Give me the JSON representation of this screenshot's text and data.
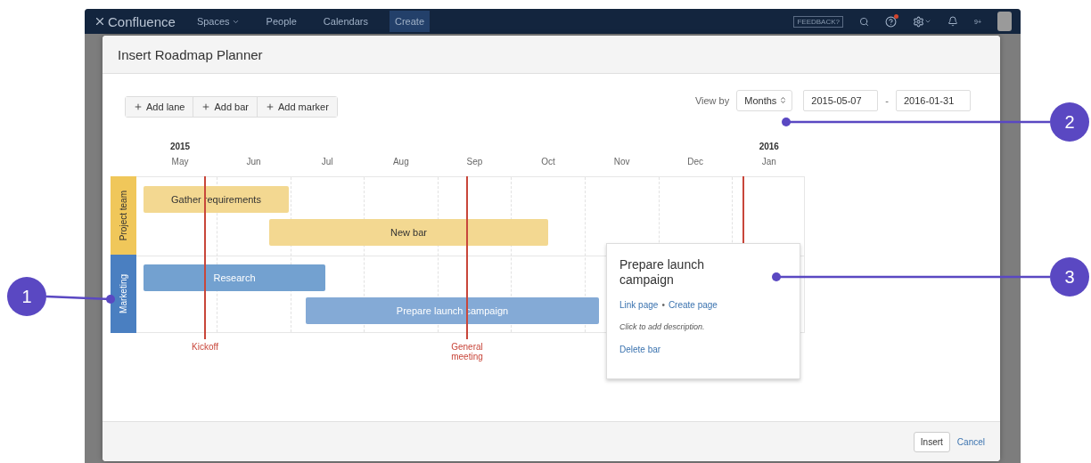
{
  "app": {
    "logo": "Confluence",
    "nav": [
      {
        "label": "Spaces",
        "dropdown": true,
        "selected": false
      },
      {
        "label": "People",
        "dropdown": false,
        "selected": false
      },
      {
        "label": "Calendars",
        "dropdown": false,
        "selected": false
      },
      {
        "label": "Create",
        "dropdown": false,
        "selected": true
      }
    ],
    "feedback": "FEEDBACK?",
    "notification_count": "9+"
  },
  "dialog": {
    "title": "Insert Roadmap Planner",
    "toolbar": [
      "Add lane",
      "Add bar",
      "Add marker"
    ],
    "view_by": {
      "label": "View by",
      "value": "Months"
    },
    "range": {
      "start": "2015-05-07",
      "separator": "-",
      "end": "2016-01-31"
    },
    "months": [
      {
        "label": "May",
        "year": "2015"
      },
      {
        "label": "Jun"
      },
      {
        "label": "Jul"
      },
      {
        "label": "Aug"
      },
      {
        "label": "Sep"
      },
      {
        "label": "Oct"
      },
      {
        "label": "Nov"
      },
      {
        "label": "Dec"
      },
      {
        "label": "Jan",
        "year": "2016"
      }
    ],
    "lanes": [
      {
        "name": "Project team",
        "color": "#f0c75a",
        "bars": [
          {
            "label": "Gather requirements",
            "color": "#f3d891"
          },
          {
            "label": "New bar",
            "color": "#f3d891"
          }
        ]
      },
      {
        "name": "Marketing",
        "color": "#4a7fc1",
        "bars": [
          {
            "label": "Research",
            "color": "#73a1d0"
          },
          {
            "label": "Prepare launch campaign",
            "color": "#84aad6"
          }
        ]
      }
    ],
    "markers": [
      {
        "kind": "labeled",
        "label": "Kickoff"
      },
      {
        "kind": "labeled",
        "label": "General meeting"
      },
      {
        "kind": "line"
      }
    ],
    "popover": {
      "title": "Prepare launch campaign",
      "links": [
        "Link page",
        "Create page"
      ],
      "separator": "•",
      "description_placeholder": "Click to add description.",
      "delete": "Delete bar"
    },
    "footer": {
      "primary": "Insert",
      "cancel": "Cancel"
    }
  },
  "callouts": [
    "1",
    "2",
    "3"
  ]
}
